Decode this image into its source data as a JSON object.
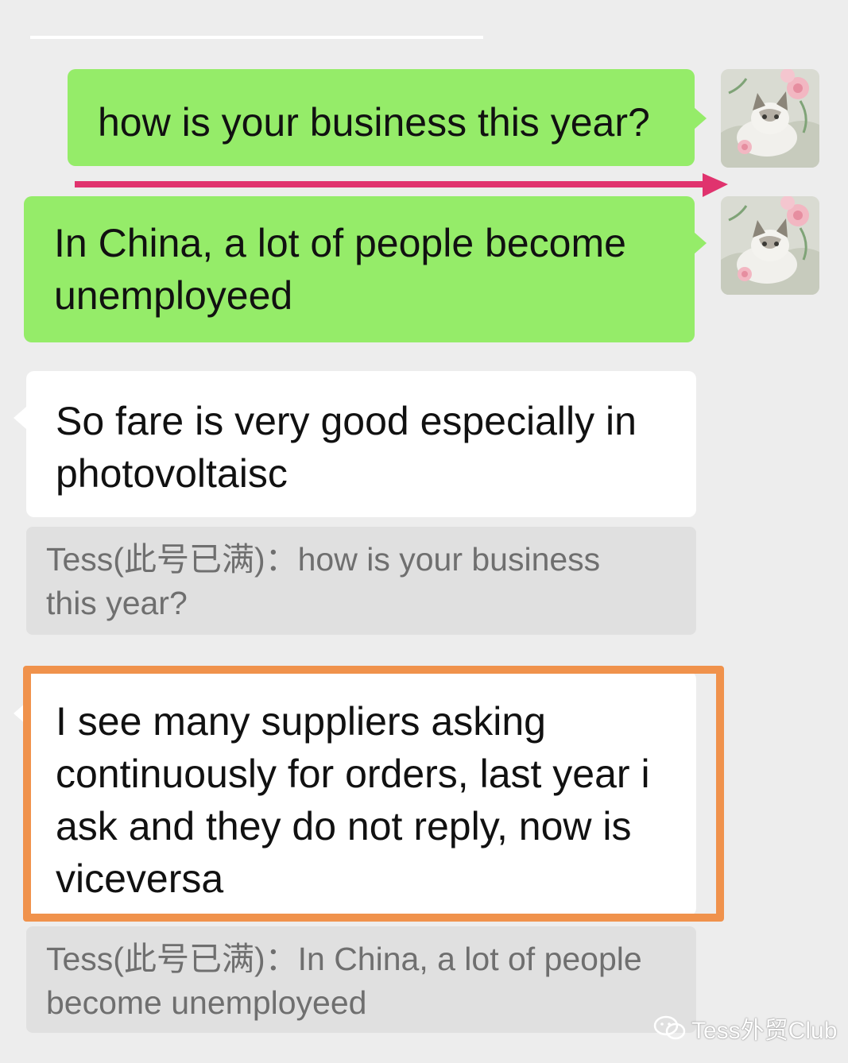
{
  "messages": {
    "m1": {
      "text": "how is your business this year?"
    },
    "m2": {
      "text": "In China, a lot of people become unemployeed"
    },
    "m3": {
      "text": "So fare is very good especially in photovoltaisc",
      "quote": "Tess(此号已满)：how is your business this year?"
    },
    "m4": {
      "text": "I see many suppliers asking continuously for orders, last year i ask and they do not reply, now is viceversa",
      "quote": "Tess(此号已满)：In China, a lot of people become unemployeed"
    }
  },
  "annotations": {
    "arrow_color": "#e0336e",
    "highlight_color": "#f0924c"
  },
  "colors": {
    "sent_bubble": "#95ec69",
    "received_bubble": "#ffffff",
    "quote_bg": "#e0e0e0",
    "background": "#ededed"
  },
  "avatar": {
    "icon": "cat-with-flowers-avatar"
  },
  "watermark": {
    "icon": "wechat-logo-icon",
    "text": "Tess外贸Club"
  }
}
